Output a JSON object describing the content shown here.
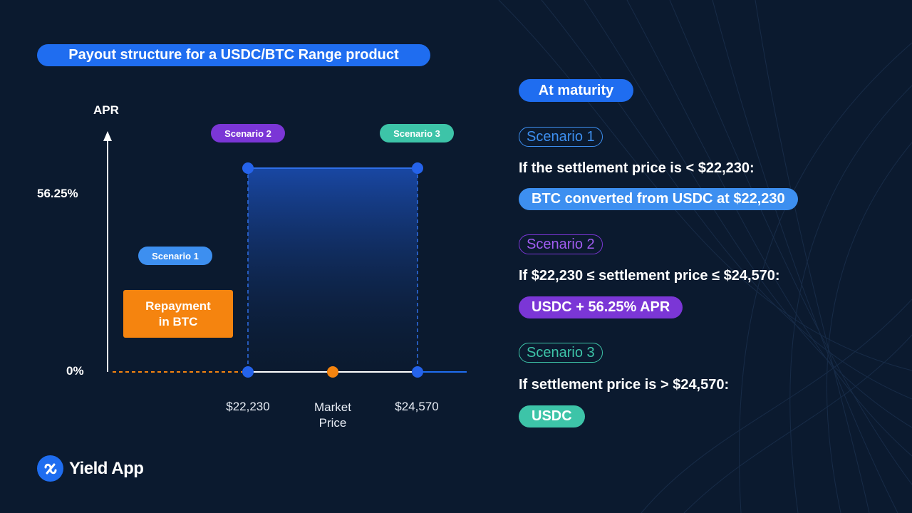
{
  "header": {
    "title": "Payout structure for a USDC/BTC Range product"
  },
  "colors": {
    "background": "#0b1a2f",
    "accent_blue": "#1f6df0",
    "scenario1": "#3d8ff0",
    "scenario2": "#7b36d6",
    "scenario3": "#3dc4a8",
    "repayment": "#f5840f",
    "axis": "#ffffff"
  },
  "chart_data": {
    "type": "area",
    "ylabel": "APR",
    "y_tick_labels": [
      "56.25%",
      "0%"
    ],
    "x_tick_labels": [
      "$22,230",
      "Market\nPrice",
      "$24,570"
    ],
    "x": [
      22230,
      24570
    ],
    "series": [
      {
        "values": [
          56.25,
          56.25
        ]
      }
    ],
    "market_price_marker": {
      "label": "Market\nPrice",
      "color": "#f5840f"
    },
    "annotations": [
      {
        "text": "Scenario 1",
        "color": "#3d8ff0"
      },
      {
        "text": "Scenario 2",
        "color": "#7b36d6"
      },
      {
        "text": "Scenario 3",
        "color": "#3dc4a8"
      },
      {
        "text": "Repayment\nin BTC",
        "color": "#f5840f"
      }
    ]
  },
  "chart_labels": {
    "ylabel": "APR",
    "y_high": "56.25%",
    "y_zero": "0%",
    "x_low": "$22,230",
    "x_market_line1": "Market",
    "x_market_line2": "Price",
    "x_high": "$24,570",
    "scenario1_tag": "Scenario 1",
    "scenario2_tag": "Scenario 2",
    "scenario3_tag": "Scenario 3",
    "repay_line1": "Repayment",
    "repay_line2": "in BTC"
  },
  "panel": {
    "heading": "At maturity",
    "scenarios": [
      {
        "label": "Scenario 1",
        "condition": "If the settlement price is < $22,230:",
        "result": "BTC converted from USDC at $22,230"
      },
      {
        "label": "Scenario 2",
        "condition": "If $22,230 ≤ settlement price ≤ $24,570:",
        "result": "USDC + 56.25% APR"
      },
      {
        "label": "Scenario 3",
        "condition": "If settlement price is > $24,570:",
        "result": "USDC"
      }
    ]
  },
  "brand": {
    "name": "Yield App",
    "icon": "yield-app-logo-icon"
  }
}
